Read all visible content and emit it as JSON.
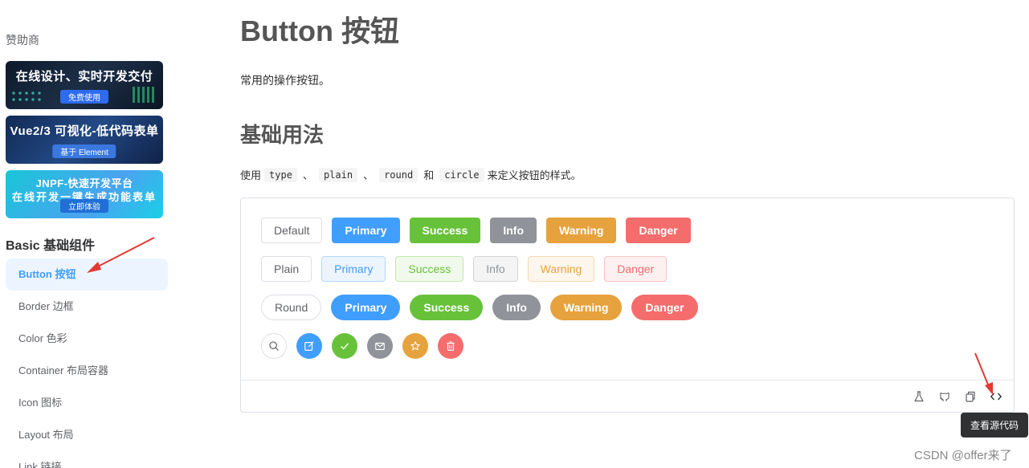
{
  "sidebar": {
    "sponsor_title": "赞助商",
    "banners": [
      {
        "line1": "在线设计、实时开发交付",
        "line2": "免费使用"
      },
      {
        "line1": "Vue2/3 可视化-低代码表单",
        "line2": "基于 Element"
      },
      {
        "line1": "JNPF-快速开发平台",
        "line1b": "在线开发一键生成功能表单",
        "line2": "立即体验"
      }
    ],
    "group_title": "Basic 基础组件",
    "items": [
      {
        "label": "Button 按钮",
        "active": true
      },
      {
        "label": "Border 边框"
      },
      {
        "label": "Color 色彩"
      },
      {
        "label": "Container 布局容器"
      },
      {
        "label": "Icon 图标"
      },
      {
        "label": "Layout 布局"
      },
      {
        "label": "Link 链接"
      }
    ]
  },
  "main": {
    "title": "Button 按钮",
    "description": "常用的操作按钮。",
    "section_title": "基础用法",
    "usage": {
      "prefix": "使用",
      "codes": [
        "type",
        "plain",
        "round",
        "circle"
      ],
      "sep1": "、",
      "sep2": "、",
      "and": "和",
      "suffix": "来定义按钮的样式。"
    },
    "rows": {
      "basic": [
        "Default",
        "Primary",
        "Success",
        "Info",
        "Warning",
        "Danger"
      ],
      "plain": [
        "Plain",
        "Primary",
        "Success",
        "Info",
        "Warning",
        "Danger"
      ],
      "round": [
        "Round",
        "Primary",
        "Success",
        "Info",
        "Warning",
        "Danger"
      ],
      "circle_icons": [
        "search-icon",
        "edit-icon",
        "check-icon",
        "message-icon",
        "star-icon",
        "delete-icon"
      ]
    },
    "footer_icons": [
      "flask-icon",
      "github-icon",
      "copy-icon",
      "code-icon"
    ],
    "tooltip": "查看源代码"
  },
  "watermark": "CSDN @offer来了",
  "colors": {
    "primary": "#409eff",
    "success": "#67c23a",
    "info": "#909399",
    "warning": "#e6a23c",
    "danger": "#f56c6c",
    "arrow": "#e53935"
  }
}
